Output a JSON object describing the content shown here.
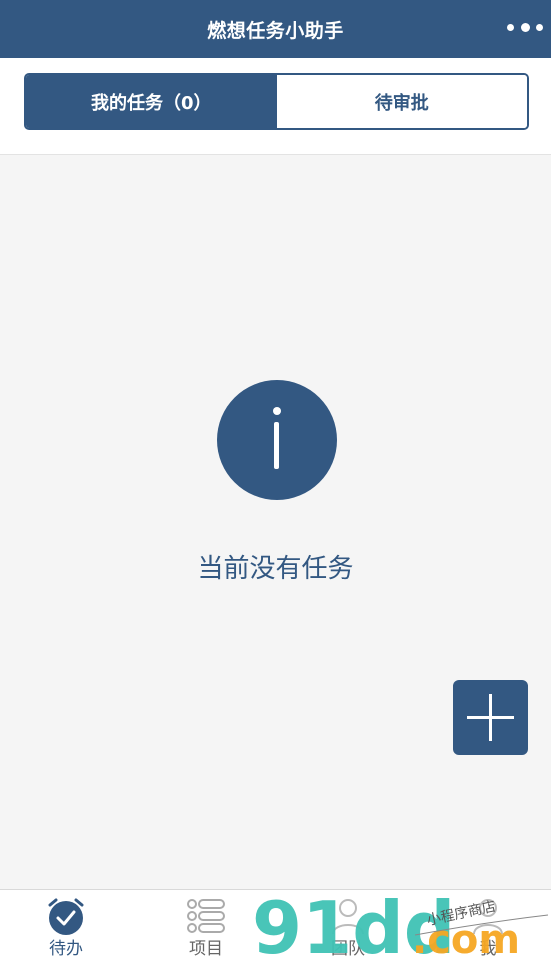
{
  "navbar": {
    "title": "燃想任务小助手",
    "menu_icon": "more-dots-icon"
  },
  "tabs": [
    {
      "label": "我的任务（0）",
      "active": true
    },
    {
      "label": "待审批",
      "active": false
    }
  ],
  "empty_state": {
    "icon": "info-icon",
    "message": "当前没有任务"
  },
  "fab": {
    "icon": "plus-icon"
  },
  "tabbar": [
    {
      "label": "待办",
      "icon": "alarm-check-icon",
      "active": true
    },
    {
      "label": "项目",
      "icon": "list-icon",
      "active": false
    },
    {
      "label": "团队",
      "icon": "team-icon",
      "active": false
    },
    {
      "label": "我",
      "icon": "person-icon",
      "active": false
    }
  ],
  "watermark": {
    "logo": "91dd",
    "domain": ".com",
    "caption": "小程序商店"
  },
  "colors": {
    "primary": "#335882",
    "background": "#f5f5f5",
    "watermark_teal": "#3fc2b4",
    "watermark_orange": "#f5a623"
  }
}
